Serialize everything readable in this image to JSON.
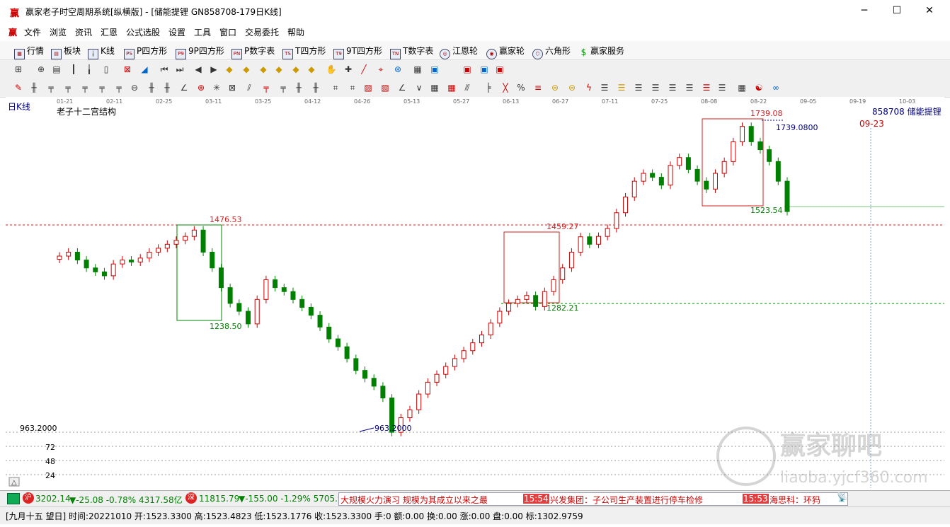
{
  "window": {
    "title": "赢家老子时空周期系统[纵横版] - [储能提锂  GN858708-179日K线]",
    "controls": [
      "─",
      "☐",
      "✕"
    ]
  },
  "menu": [
    "文件",
    "浏览",
    "资讯",
    "汇恩",
    "公式选股",
    "设置",
    "工具",
    "窗口",
    "交易委托",
    "帮助"
  ],
  "toolbar1": [
    {
      "icon": "grid-icon",
      "label": "行情"
    },
    {
      "icon": "blocks-icon",
      "label": "板块"
    },
    {
      "icon": "kline-icon",
      "label": "K线"
    },
    {
      "icon": "ps-icon",
      "label": "P四方形"
    },
    {
      "icon": "p9-icon",
      "label": "9P四方形"
    },
    {
      "icon": "pn-icon",
      "label": "P数字表"
    },
    {
      "icon": "ts-icon",
      "label": "T四方形"
    },
    {
      "icon": "t9-icon",
      "label": "9T四方形"
    },
    {
      "icon": "tn-icon",
      "label": "T数字表"
    },
    {
      "icon": "wheel-icon",
      "label": "江恩轮"
    },
    {
      "icon": "winner-wheel-icon",
      "label": "赢家轮"
    },
    {
      "icon": "hexagon-icon",
      "label": "六角形"
    },
    {
      "icon": "dollar-icon",
      "label": "赢家服务"
    }
  ],
  "chart": {
    "period_label": "日K线",
    "indicator_title": "老子十二宫结构",
    "stock_tag": "858708  储能提锂",
    "date_ticks": [
      "01-21",
      "02-11",
      "02-25",
      "03-11",
      "03-25",
      "04-12",
      "04-26",
      "05-13",
      "05-27",
      "06-13",
      "06-27",
      "07-11",
      "07-25",
      "08-08",
      "08-22",
      "09-05",
      "09-19",
      "10-03"
    ],
    "highlight_date": "09-23",
    "price_labels": {
      "high": "1739.08",
      "high_marker": "1739.0800",
      "box1_top": "1476.53",
      "box1_bottom": "1238.50",
      "box2_top": "1459.27",
      "box2_bottom": "1282.21",
      "box3_bottom": "1523.54",
      "low_marker": "963.2000",
      "axis_low": "963.2000"
    },
    "volume_axis": [
      "72",
      "48",
      "24"
    ],
    "colors": {
      "up": "#cc0000",
      "down": "#008000",
      "box": "#cc2222",
      "box1": "#008000",
      "marker": "#000080"
    }
  },
  "chart_data": {
    "type": "candlestick",
    "xlabel": "",
    "ylabel": "",
    "ylim": [
      963.2,
      1760
    ],
    "candles_approx_close": [
      1410,
      1420,
      1400,
      1380,
      1370,
      1360,
      1390,
      1400,
      1395,
      1405,
      1420,
      1430,
      1440,
      1450,
      1460,
      1476,
      1420,
      1380,
      1330,
      1290,
      1270,
      1238,
      1300,
      1350,
      1330,
      1320,
      1300,
      1280,
      1260,
      1230,
      1200,
      1180,
      1150,
      1120,
      1100,
      1080,
      1050,
      963,
      1000,
      1020,
      1060,
      1090,
      1110,
      1130,
      1150,
      1170,
      1190,
      1210,
      1240,
      1270,
      1290,
      1300,
      1310,
      1282,
      1320,
      1350,
      1380,
      1420,
      1459,
      1440,
      1460,
      1480,
      1520,
      1560,
      1600,
      1620,
      1610,
      1590,
      1640,
      1660,
      1630,
      1600,
      1580,
      1620,
      1650,
      1700,
      1739,
      1700,
      1680,
      1650,
      1600,
      1523
    ]
  },
  "status1": {
    "index1_icon": "沪",
    "index1": "3202.14",
    "index1_change": "▼-25.08 -0.78% 4317.58亿",
    "index2_icon": "深",
    "index2": "11815.79",
    "index2_change": "▼-155.00 -1.29% 5705.9",
    "news": [
      {
        "time": "",
        "text": "大规模火力演习 规模为其成立以来之最"
      },
      {
        "time": "15:54",
        "text": "兴发集团：子公司生产装置进行停车检修"
      },
      {
        "time": "15:53",
        "text": "海思科：环犸"
      }
    ],
    "antenna": "📡"
  },
  "status2": {
    "text": "[九月十五  望日] 时间:20221010 开:1523.3300 高:1523.4823 低:1523.1776 收:1523.3300 手:0 额:0.00 换:0.00 涨:0.00 盘:0.00 标:1302.9759"
  },
  "watermark": {
    "line1": "赢家聊吧",
    "line2": "liaoba.yjcf360.com"
  }
}
